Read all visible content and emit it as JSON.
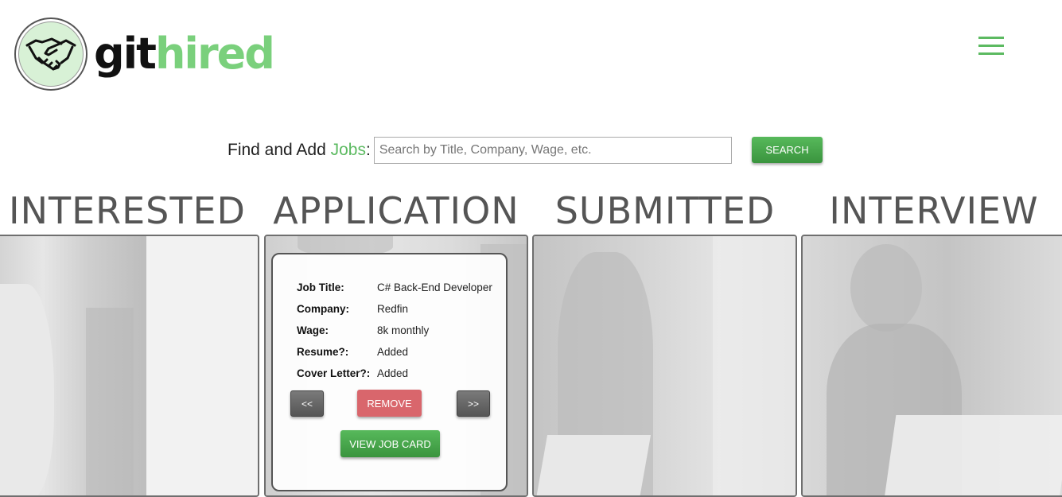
{
  "brand": {
    "git": "git",
    "hired": "hired"
  },
  "search": {
    "prefix": "Find and Add ",
    "jobs_word": "Jobs",
    "suffix": ":",
    "placeholder": "Search by Title, Company, Wage, etc.",
    "button_label": "SEARCH"
  },
  "columns": [
    {
      "title": "INTERESTED"
    },
    {
      "title": "APPLICATION"
    },
    {
      "title": "SUBMITTED"
    },
    {
      "title": "INTERVIEW"
    }
  ],
  "job_card": {
    "fields": [
      {
        "label": "Job Title:",
        "value": "C# Back-End Developer"
      },
      {
        "label": "Company:",
        "value": "Redfin"
      },
      {
        "label": "Wage:",
        "value": "8k monthly"
      },
      {
        "label": "Resume?:",
        "value": "Added"
      },
      {
        "label": "Cover Letter?:",
        "value": "Added"
      }
    ],
    "prev_label": "<<",
    "remove_label": "REMOVE",
    "next_label": ">>",
    "view_label": "VIEW JOB CARD"
  },
  "colors": {
    "accent_green": "#5cba61",
    "logo_circle": "#d8f1d6",
    "remove_red": "#d9666c",
    "column_title": "#555555"
  },
  "icons": {
    "logo": "handshake-icon",
    "menu": "hamburger-menu-icon"
  }
}
